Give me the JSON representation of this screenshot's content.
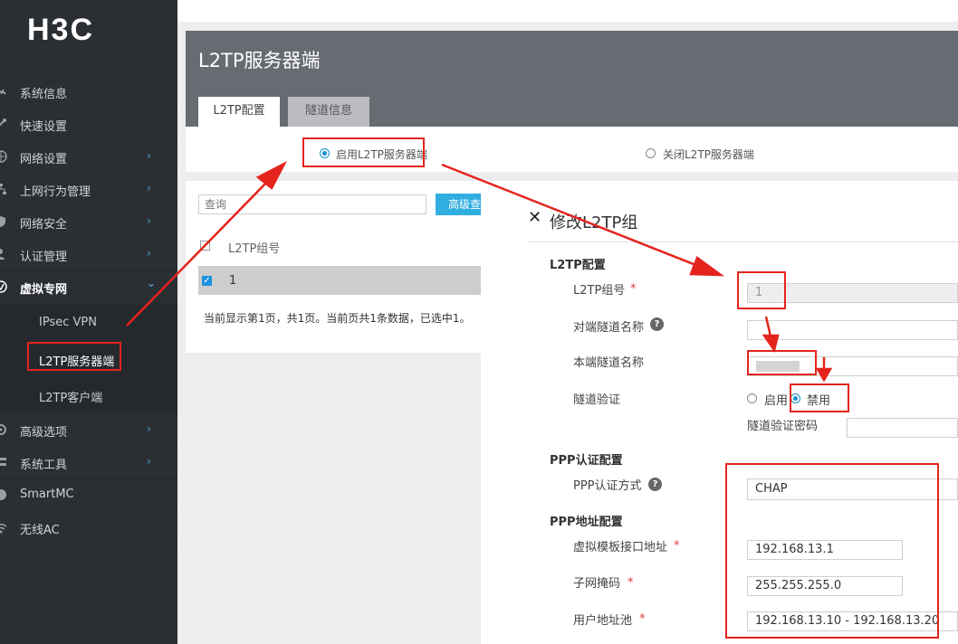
{
  "brand": {
    "logo": "H3C"
  },
  "sidebar": {
    "items": [
      {
        "label": "系统信息",
        "icon": "dashboard-icon",
        "chevron": false
      },
      {
        "label": "快速设置",
        "icon": "wand-icon",
        "chevron": false
      },
      {
        "label": "网络设置",
        "icon": "globe-icon",
        "chevron": true
      },
      {
        "label": "上网行为管理",
        "icon": "sitemap-icon",
        "chevron": true
      },
      {
        "label": "网络安全",
        "icon": "shield-icon",
        "chevron": true
      },
      {
        "label": "认证管理",
        "icon": "user-check-icon",
        "chevron": true
      },
      {
        "label": "虚拟专网",
        "icon": "vpn-icon",
        "chevron": true
      },
      {
        "label": "高级选项",
        "icon": "settings-icon",
        "chevron": true
      },
      {
        "label": "系统工具",
        "icon": "tools-icon",
        "chevron": true
      },
      {
        "label": "SmartMC",
        "icon": "smartmc-icon",
        "chevron": false
      },
      {
        "label": "无线AC",
        "icon": "wifi-icon",
        "chevron": false
      }
    ],
    "vpn_sub": [
      {
        "label": "IPsec VPN"
      },
      {
        "label": "L2TP服务器端"
      },
      {
        "label": "L2TP客户端"
      }
    ],
    "chevron_glyph": "›",
    "open_chevron_glyph": "⌄"
  },
  "header": {
    "title": "L2TP服务器端"
  },
  "tabs": [
    {
      "label": "L2TP配置"
    },
    {
      "label": "隧道信息"
    }
  ],
  "server_toggle": {
    "enable_label": "启用L2TP服务器端",
    "disable_label": "关闭L2TP服务器端",
    "selected": "enable"
  },
  "list": {
    "query_placeholder": "查询",
    "adv_button": "高级查询",
    "column": "L2TP组号",
    "rows": [
      {
        "group": "1",
        "checked": true
      }
    ],
    "status": "当前显示第1页，共1页。当前页共1条数据，已选中1。"
  },
  "dialog": {
    "close_glyph": "✕",
    "title": "修改L2TP组",
    "sections": {
      "l2tp": "L2TP配置",
      "ppp_auth": "PPP认证配置",
      "ppp_addr": "PPP地址配置"
    },
    "fields": {
      "group_no": {
        "label": "L2TP组号",
        "value": "1",
        "required": "*"
      },
      "peer_name": {
        "label": "对端隧道名称",
        "value": ""
      },
      "local_name": {
        "label": "本端隧道名称",
        "value": ""
      },
      "tunnel_auth": {
        "label": "隧道验证",
        "enable": "启用",
        "disable": "禁用",
        "selected": "disable"
      },
      "tunnel_pwd": {
        "label": "隧道验证密码",
        "value": ""
      },
      "ppp_method": {
        "label": "PPP认证方式",
        "value": "CHAP"
      },
      "vt_addr": {
        "label": "虚拟模板接口地址",
        "value": "192.168.13.1",
        "required": "*"
      },
      "mask": {
        "label": "子网掩码",
        "value": "255.255.255.0",
        "required": "*"
      },
      "pool": {
        "label": "用户地址池",
        "value": "192.168.13.10 - 192.168.13.20",
        "required": "*"
      }
    },
    "help_glyph": "?"
  },
  "colors": {
    "sidebar": "#2b2f33",
    "header": "#676b72",
    "accent": "#1890d0",
    "annotation": "#e4241d",
    "required": "#e03b3b"
  }
}
